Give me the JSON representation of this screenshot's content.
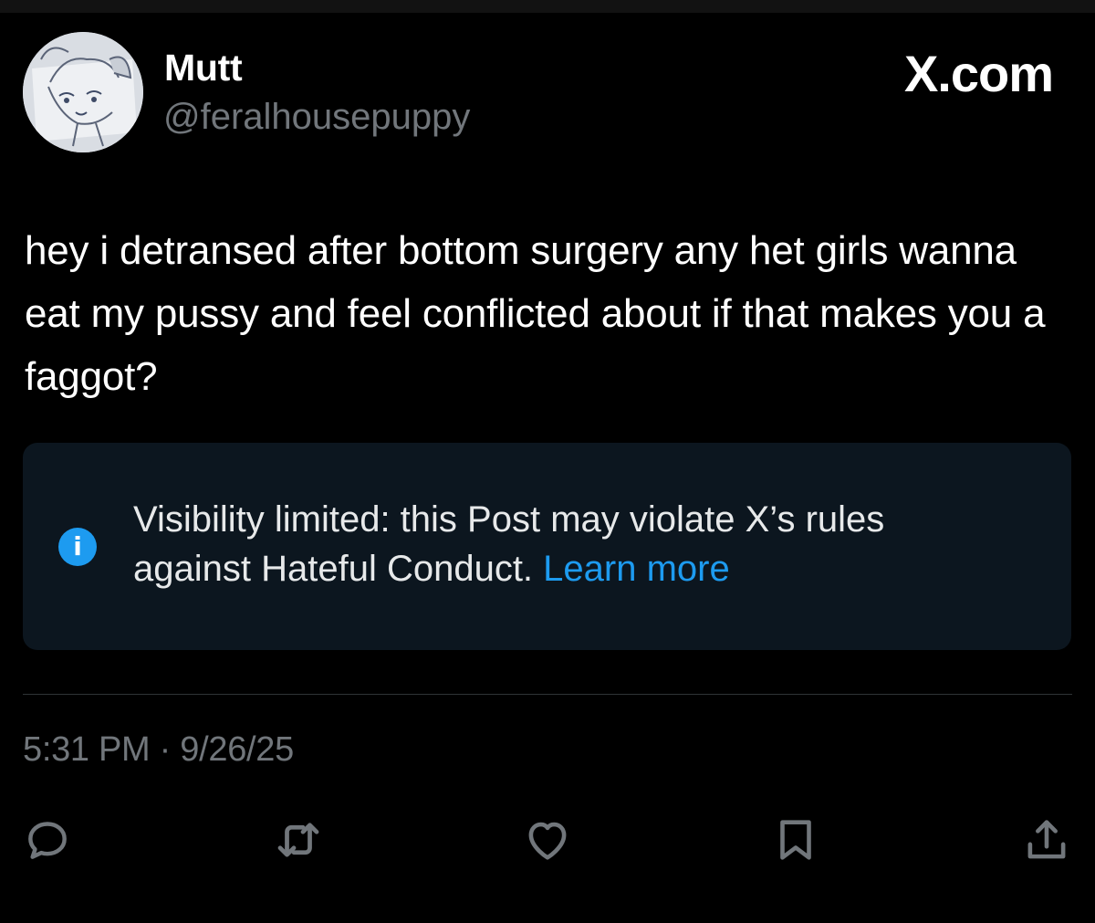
{
  "site": {
    "brand": "X.com"
  },
  "post": {
    "author": {
      "display_name": "Mutt",
      "handle": "@feralhousepuppy",
      "avatar_icon": "sketch-avatar"
    },
    "text": "hey i detransed after bottom surgery any het girls wanna eat my pussy and feel conflicted about if that makes you a faggot?",
    "notice": {
      "icon": "info-icon",
      "text": "Visibility limited: this Post may violate X’s rules against Hateful Conduct.",
      "link_label": "Learn more"
    },
    "timestamp": "5:31 PM · 9/26/25"
  },
  "actions": [
    {
      "name": "reply",
      "icon": "reply-icon"
    },
    {
      "name": "repost",
      "icon": "repost-icon"
    },
    {
      "name": "like",
      "icon": "like-icon"
    },
    {
      "name": "bookmark",
      "icon": "bookmark-icon"
    },
    {
      "name": "share",
      "icon": "share-icon"
    }
  ],
  "colors": {
    "background": "#000000",
    "notice_background": "#0c161f",
    "accent": "#1d9bf0",
    "muted_text": "#71767b",
    "primary_text": "#ffffff"
  }
}
